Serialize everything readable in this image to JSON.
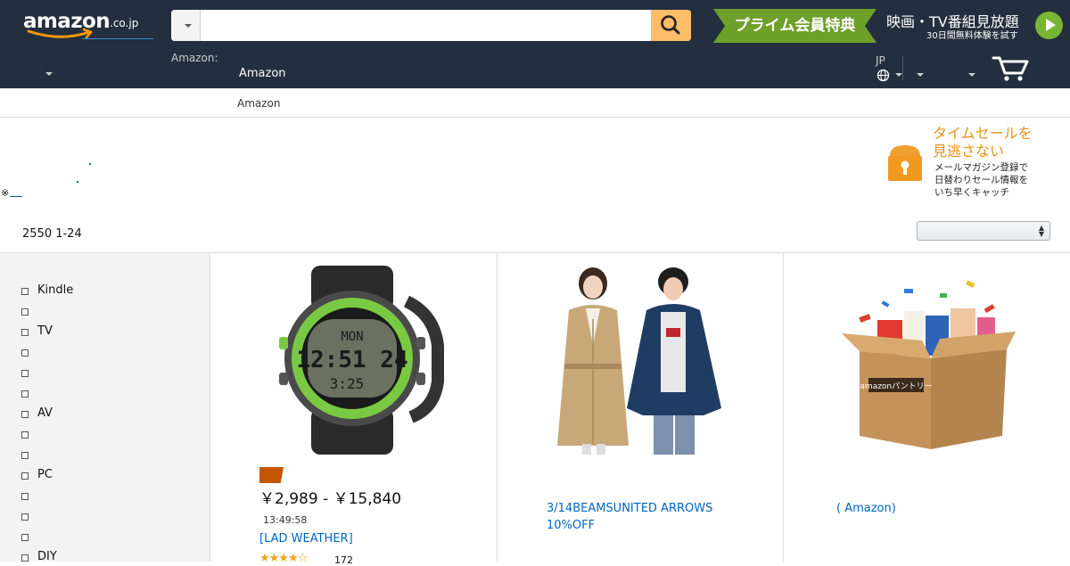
{
  "nav": {
    "logo_text": "amazon",
    "logo_tld": ".co.jp",
    "search_placeholder": "",
    "prime_banner_text": "プライム会員特典",
    "promo_line1": "映画・TV番組見放題",
    "promo_line2": "30日間無料体験を試す",
    "account_small": "Amazon:",
    "account_big": "Amazon",
    "language": "JP"
  },
  "subnav": {
    "link": "Amazon"
  },
  "banner": {
    "note_mark": "※",
    "timesale_title_line1": "タイムセールを",
    "timesale_title_line2": "見逃さない",
    "timesale_sub_line1": "メールマガジン登録で",
    "timesale_sub_line2": "日替わりセール情報を",
    "timesale_sub_line3": "いち早くキャッチ"
  },
  "results": {
    "count": "2550 1-24",
    "sort_value": ""
  },
  "sidebar": {
    "items": [
      {
        "label": "Kindle"
      },
      {
        "label": ""
      },
      {
        "label": "TV"
      },
      {
        "label": ""
      },
      {
        "label": ""
      },
      {
        "label": ""
      },
      {
        "label": "AV"
      },
      {
        "label": ""
      },
      {
        "label": ""
      },
      {
        "label": "PC"
      },
      {
        "label": ""
      },
      {
        "label": ""
      },
      {
        "label": ""
      },
      {
        "label": "DIY"
      }
    ]
  },
  "products": [
    {
      "price": "￥2,989 - ￥15,840",
      "timer": "13:49:58",
      "title": "[LAD WEATHER]",
      "rating": 3.5,
      "rating_count": "172",
      "watch_digits_top": "MON",
      "watch_digits_mid": "12:51 24",
      "watch_digits_bot": "3:25"
    },
    {
      "title_line1": "3/14BEAMSUNITED ARROWS",
      "title_line2": "10%OFF"
    },
    {
      "title": "( Amazon)",
      "box_label": "amazonパントリー"
    }
  ],
  "colors": {
    "nav_bg": "#232f3e",
    "search_btn": "#febd69",
    "link": "#0066c0",
    "deal_badge": "#c45500",
    "timesale_orange": "#e7931a",
    "prime_green": "#6fa02a"
  }
}
